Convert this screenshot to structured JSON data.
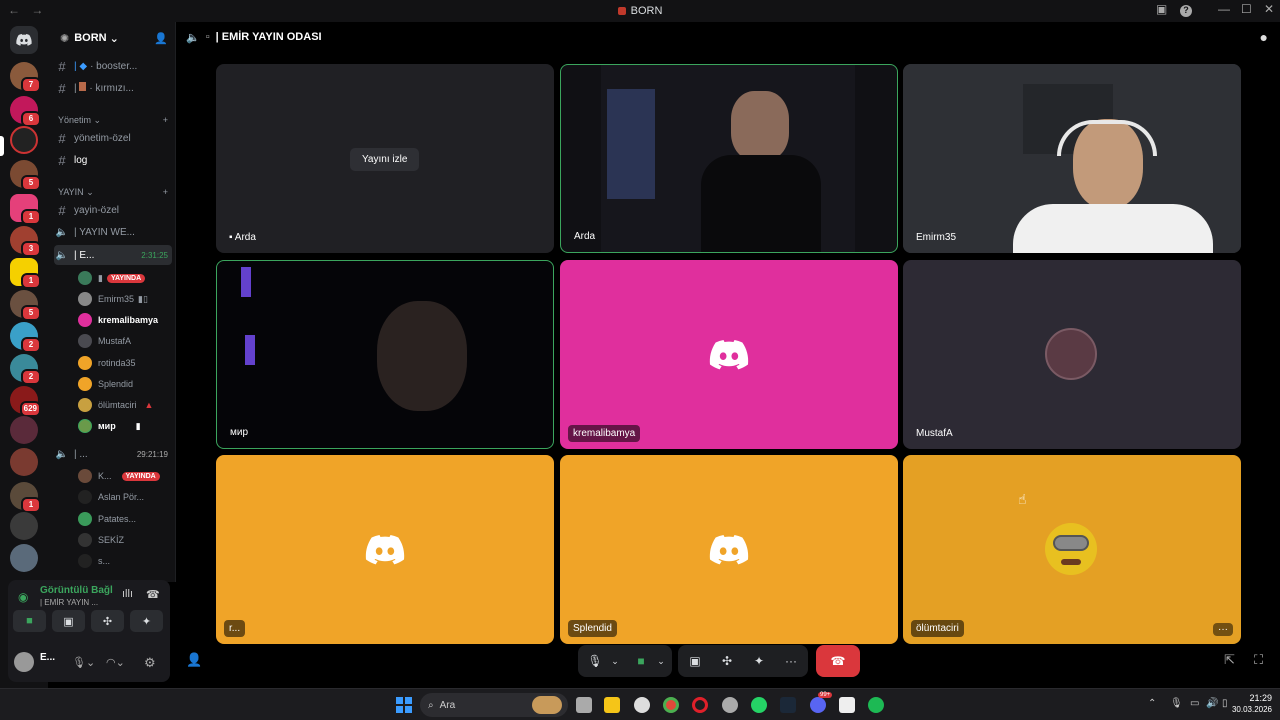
{
  "window": {
    "title": "BORN"
  },
  "server": {
    "name": "BORN"
  },
  "channels": {
    "c1": "· booster...",
    "c2": "· kırmızı...",
    "cat1": "Yönetim",
    "c3": "yönetim-özel",
    "c4": "log",
    "cat2": "YAYIN",
    "c5": "yayin-özel",
    "c6": "| YAYIN WE...",
    "active": "| E...",
    "active_time": "2:31:25",
    "voice2": "| ...",
    "voice2_time": "29:21:19"
  },
  "voice_users": [
    {
      "name": "",
      "live": "YAYINDA"
    },
    {
      "name": "Emirm35"
    },
    {
      "name": "kremalibamya"
    },
    {
      "name": "MustafA"
    },
    {
      "name": "rotinda35"
    },
    {
      "name": "Splendid"
    },
    {
      "name": "ölümtaciri"
    },
    {
      "name": "мир"
    }
  ],
  "voice_users2": [
    {
      "name": "K...",
      "live": "YAYINDA"
    },
    {
      "name": "Aslan Pör..."
    },
    {
      "name": "Patates..."
    },
    {
      "name": "SEKİZ"
    },
    {
      "name": "s..."
    }
  ],
  "voice_panel": {
    "status": "Görüntülü Bağl",
    "channel": "| EMİR YAYIN ...",
    "user": "E..."
  },
  "header": {
    "channel": "| EMİR YAYIN ODASI"
  },
  "tiles": [
    {
      "name": "Arda",
      "button": "Yayını izle"
    },
    {
      "name": "Arda"
    },
    {
      "name": "Emirm35"
    },
    {
      "name": "мир"
    },
    {
      "name": "kremalibamya"
    },
    {
      "name": "MustafA"
    },
    {
      "name": "r..."
    },
    {
      "name": "Splendid"
    },
    {
      "name": "ölümtaciri"
    }
  ],
  "badges": [
    "7",
    "6",
    "5",
    "1",
    "3",
    "1",
    "5",
    "2",
    "2",
    "629",
    "1"
  ],
  "taskbar": {
    "search": "Ara",
    "time": "21:29",
    "date": "30.03.2026",
    "discord_badge": "99+"
  },
  "colors": {
    "pink": "#e02f9d",
    "orange": "#f0a428",
    "live_red": "#da373c",
    "speaking_green": "#3ba55d"
  }
}
